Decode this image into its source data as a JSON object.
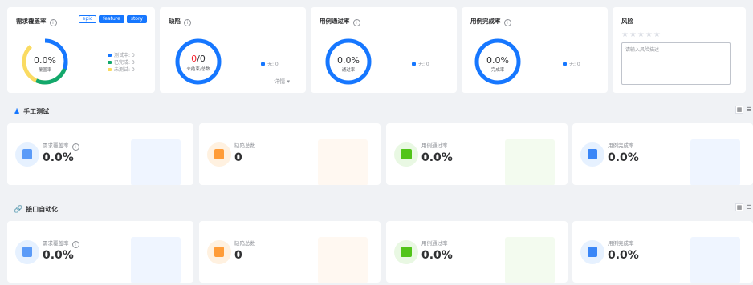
{
  "summary": {
    "coverage": {
      "title": "需求覆盖率",
      "tags": [
        "epic",
        "feature",
        "story"
      ],
      "value": "0.0%",
      "sub": "覆盖率",
      "legend": [
        {
          "label": "测试中: 0",
          "color": "#1677ff"
        },
        {
          "label": "已完成: 0",
          "color": "#13a86b"
        },
        {
          "label": "未测试: 0",
          "color": "#fadb62"
        }
      ]
    },
    "defect": {
      "title": "缺陷",
      "value_open": "0",
      "value_total": "/0",
      "sub": "未结束/总数",
      "legend": "无: 0",
      "detail": "详情 ▾"
    },
    "pass_rate": {
      "title": "用例通过率",
      "value": "0.0%",
      "sub": "通过率",
      "legend": "无: 0"
    },
    "completion_rate": {
      "title": "用例完成率",
      "value": "0.0%",
      "sub": "完成率",
      "legend": "无: 0"
    },
    "risk": {
      "title": "风险",
      "stars": "★★★★★",
      "placeholder": "请输入风险描述"
    }
  },
  "sections": [
    {
      "title": "手工测试",
      "icon": "user-icon",
      "metrics": [
        {
          "label": "需求覆盖率",
          "value": "0.0%",
          "icon": "requirement-icon"
        },
        {
          "label": "缺陷总数",
          "value": "0",
          "icon": "defect-icon"
        },
        {
          "label": "用例通过率",
          "value": "0.0%",
          "icon": "pass-icon"
        },
        {
          "label": "用例完成率",
          "value": "0.0%",
          "icon": "clipboard-icon"
        }
      ]
    },
    {
      "title": "接口自动化",
      "icon": "link-icon",
      "metrics": [
        {
          "label": "需求覆盖率",
          "value": "0.0%",
          "icon": "requirement-icon"
        },
        {
          "label": "缺陷总数",
          "value": "0",
          "icon": "defect-icon"
        },
        {
          "label": "用例通过率",
          "value": "0.0%",
          "icon": "pass-icon"
        },
        {
          "label": "用例完成率",
          "value": "0.0%",
          "icon": "clipboard-icon"
        }
      ]
    }
  ],
  "colors": {
    "primary": "#1677ff",
    "success": "#13a86b",
    "warning": "#fadb62",
    "danger": "#f5222d",
    "orange": "#ff9c38",
    "green": "#52c41a"
  }
}
